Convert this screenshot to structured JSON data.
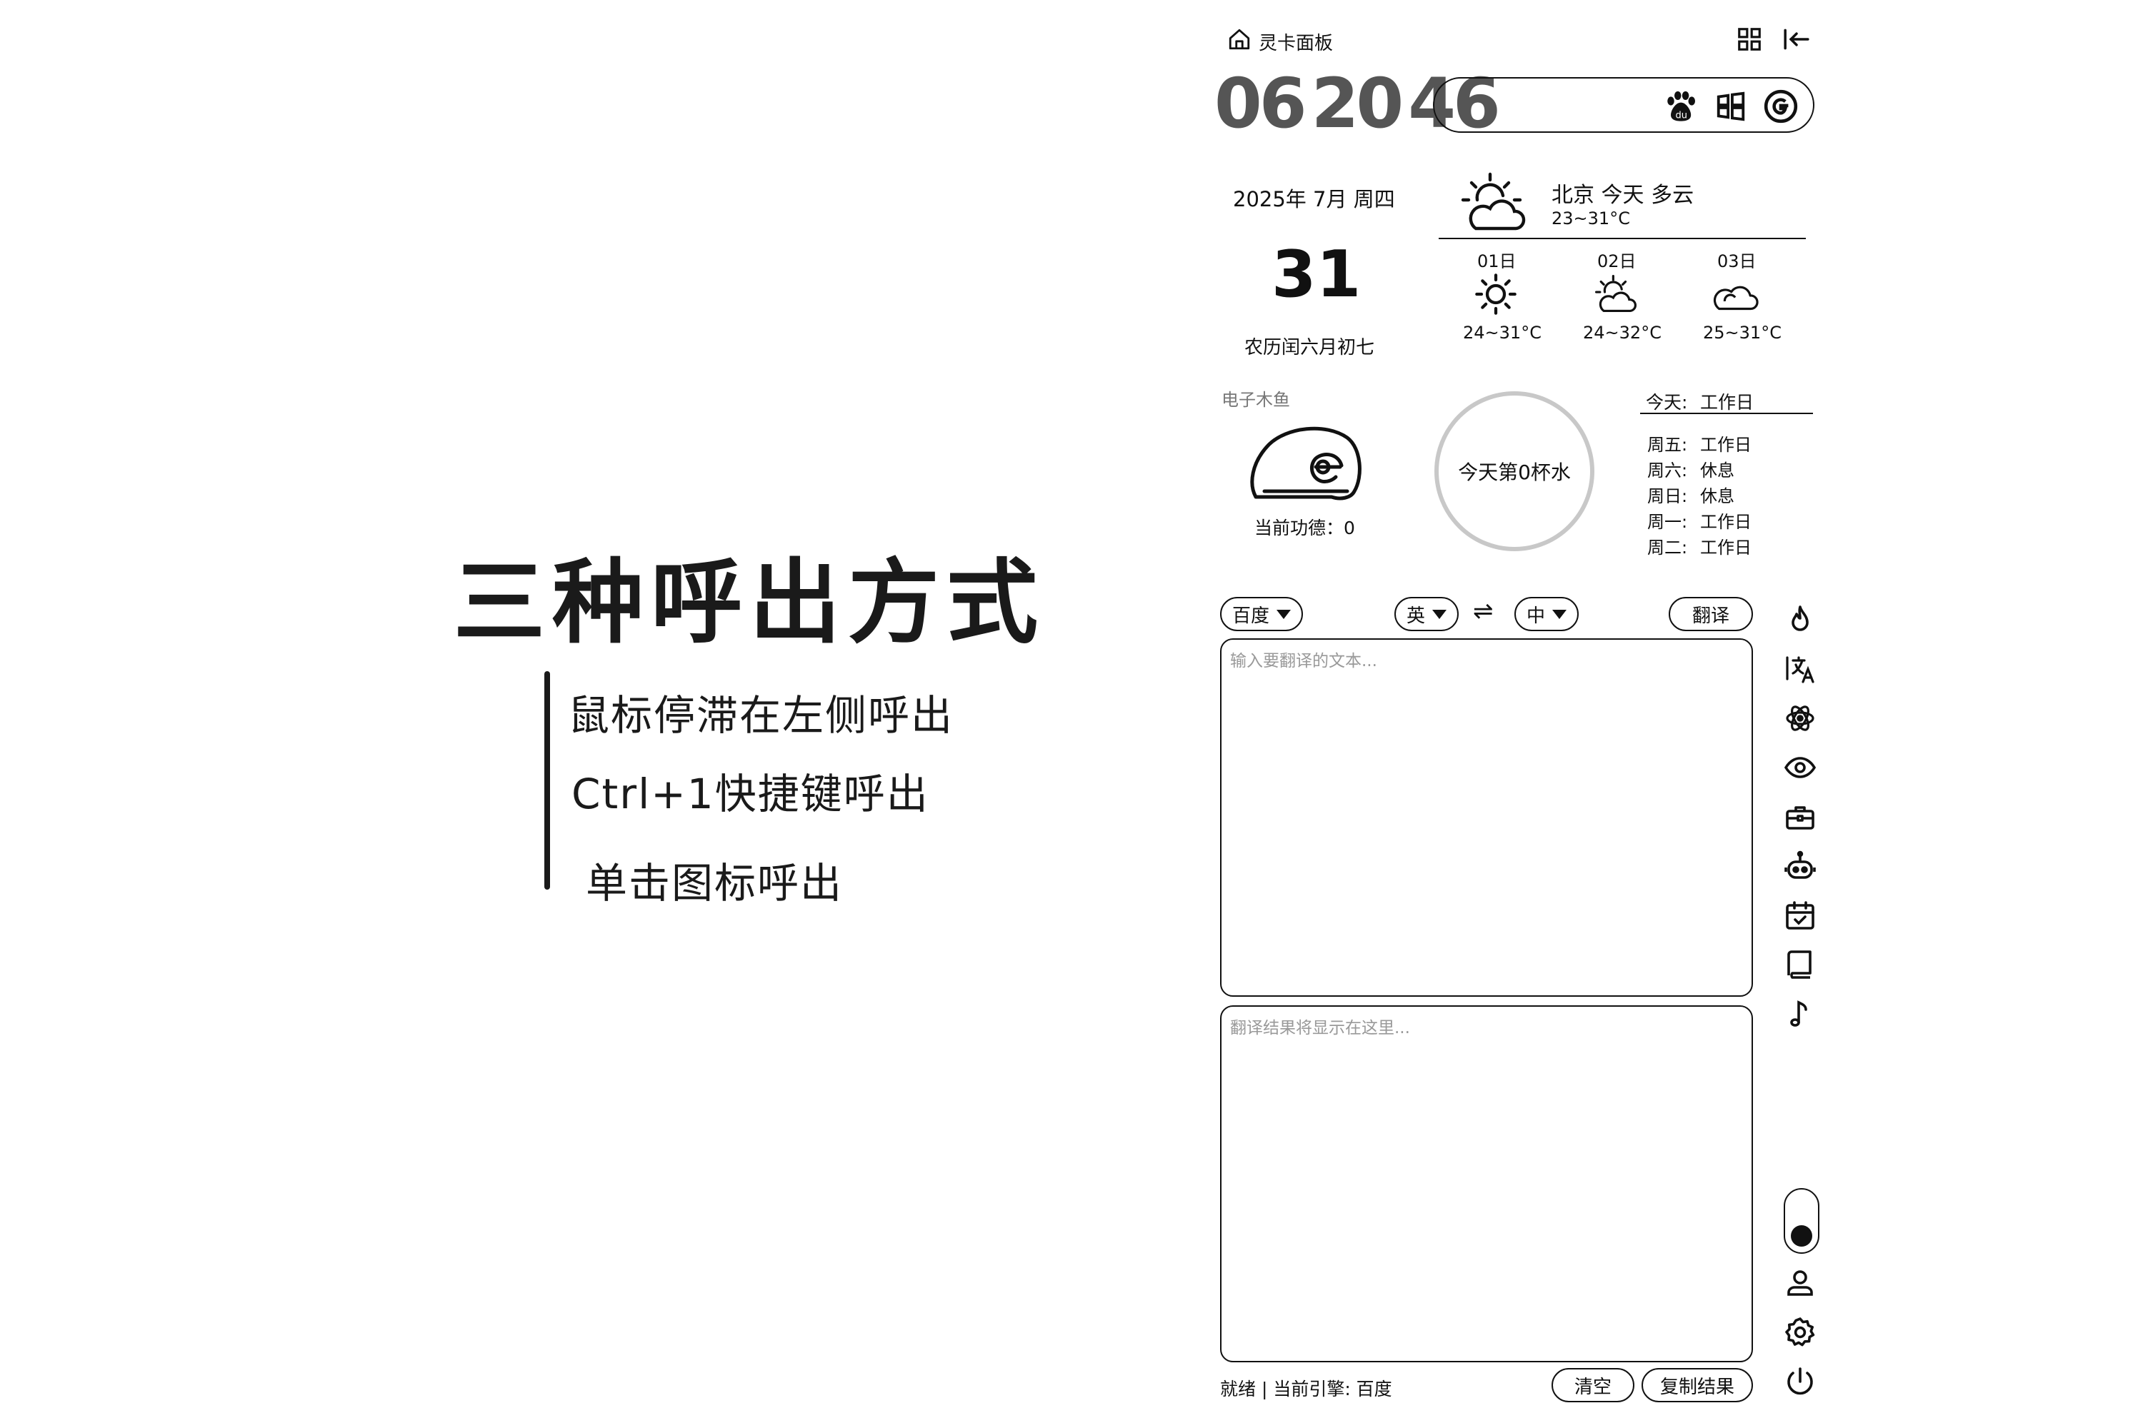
{
  "promo": {
    "title": "三种呼出方式",
    "lines": [
      "鼠标停滞在左侧呼出",
      "Ctrl+1快捷键呼出",
      "单击图标呼出"
    ]
  },
  "header": {
    "app_title": "灵卡面板"
  },
  "clock": {
    "hours": "06",
    "minutes": "20",
    "seconds": "46"
  },
  "search": {
    "placeholder": "",
    "engines": [
      "baidu-icon",
      "windows-icon",
      "google-icon"
    ]
  },
  "calendar": {
    "year_month_weekday": "2025年 7月 周四",
    "day": "31",
    "lunar": "农历闰六月初七"
  },
  "weather": {
    "city_today": "北京 今天 多云",
    "today_range": "23~31°C",
    "forecast": [
      {
        "day": "01日",
        "icon": "sun-icon",
        "range": "24~31°C"
      },
      {
        "day": "02日",
        "icon": "partly-cloudy-icon",
        "range": "24~32°C"
      },
      {
        "day": "03日",
        "icon": "cloud-icon",
        "range": "25~31°C"
      }
    ]
  },
  "muyu": {
    "label": "电子木鱼",
    "merit": "当前功德：0"
  },
  "water": {
    "text": "今天第0杯水"
  },
  "workdays": {
    "today_label": "今天:",
    "today_value": "工作日",
    "items": [
      {
        "day": "周五:",
        "status": "工作日"
      },
      {
        "day": "周六:",
        "status": "休息"
      },
      {
        "day": "周日:",
        "status": "休息"
      },
      {
        "day": "周一:",
        "status": "工作日"
      },
      {
        "day": "周二:",
        "status": "工作日"
      }
    ]
  },
  "translate": {
    "engine": "百度",
    "source_lang": "英",
    "swap_symbol": "⇌",
    "target_lang": "中",
    "translate_button": "翻译",
    "input_placeholder": "输入要翻译的文本...",
    "output_placeholder": "翻译结果将显示在这里...",
    "status": "就绪 | 当前引擎: 百度",
    "clear_button": "清空",
    "copy_button": "复制结果"
  },
  "sidebar_icons": [
    "flame-icon",
    "translate-icon",
    "atom-icon",
    "eye-icon",
    "toolbox-icon",
    "robot-icon",
    "calendar-check-icon",
    "book-icon",
    "music-note-icon"
  ],
  "bottom_icons": [
    "theme-toggle",
    "user-icon",
    "settings-icon",
    "power-icon"
  ]
}
